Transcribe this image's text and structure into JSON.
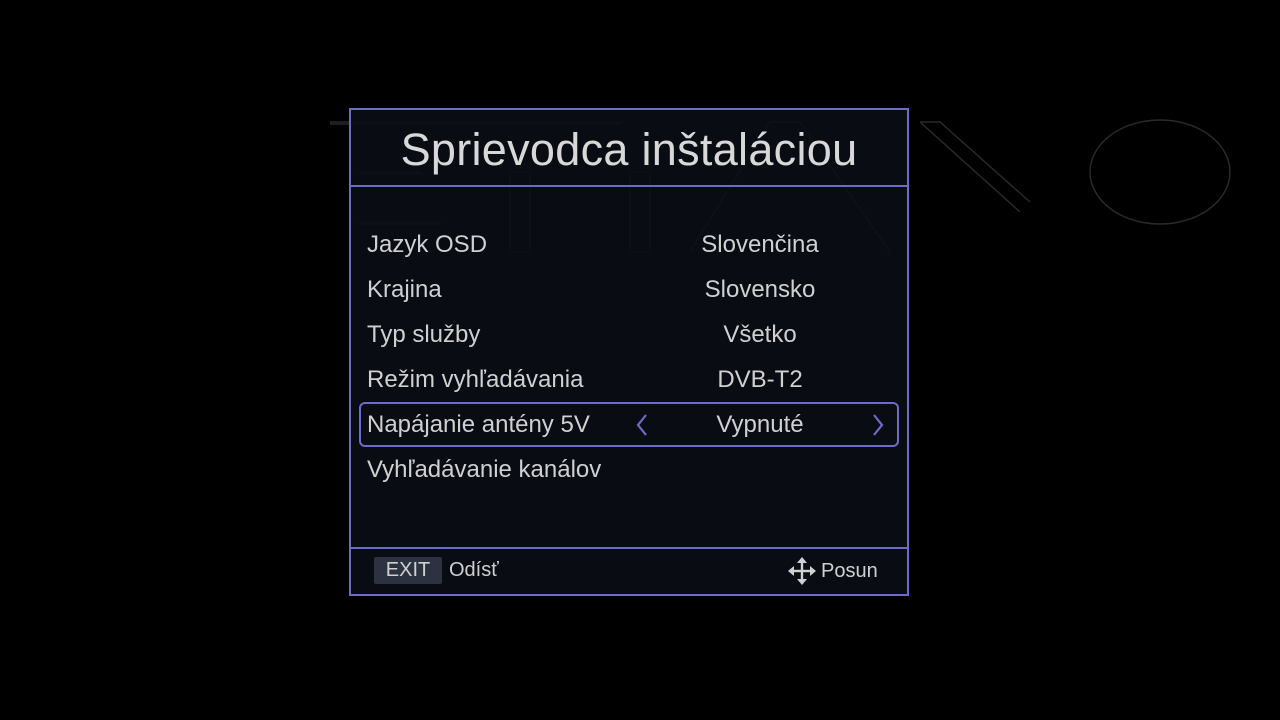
{
  "dialog": {
    "title": "Sprievodca inštaláciou"
  },
  "menu": {
    "items": [
      {
        "label": "Jazyk OSD",
        "value": "Slovenčina"
      },
      {
        "label": "Krajina",
        "value": "Slovensko"
      },
      {
        "label": "Typ služby",
        "value": "Všetko"
      },
      {
        "label": "Režim vyhľadávania",
        "value": "DVB-T2"
      },
      {
        "label": "Napájanie antény 5V",
        "value": "Vypnuté",
        "selected": true
      },
      {
        "label": "Vyhľadávanie kanálov",
        "value": ""
      }
    ]
  },
  "footer": {
    "exit_key": "EXIT",
    "exit_label": "Odísť",
    "move_label": "Posun"
  },
  "icons": {
    "left": "chevron-left-icon",
    "right": "chevron-right-icon",
    "move": "move-arrows-icon"
  },
  "colors": {
    "accent": "#6b6cc9",
    "background": "#000000",
    "text": "#d0d0d0",
    "key_bg": "#2b3340"
  }
}
